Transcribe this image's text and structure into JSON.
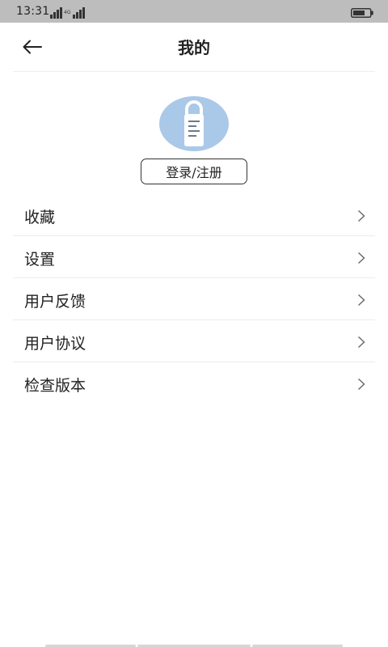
{
  "status_bar": {
    "time": "13:31",
    "signal_icon": "signal-icon",
    "battery_icon": "battery-icon"
  },
  "header": {
    "title": "我的",
    "back_icon": "arrow-left-icon"
  },
  "profile": {
    "avatar_icon": "door-hanger-icon",
    "avatar_color": "#aac8e8",
    "login_label": "登录/注册"
  },
  "menu": {
    "items": [
      {
        "label": "收藏"
      },
      {
        "label": "设置"
      },
      {
        "label": "用户反馈"
      },
      {
        "label": "用户协议"
      },
      {
        "label": "检查版本"
      }
    ]
  }
}
